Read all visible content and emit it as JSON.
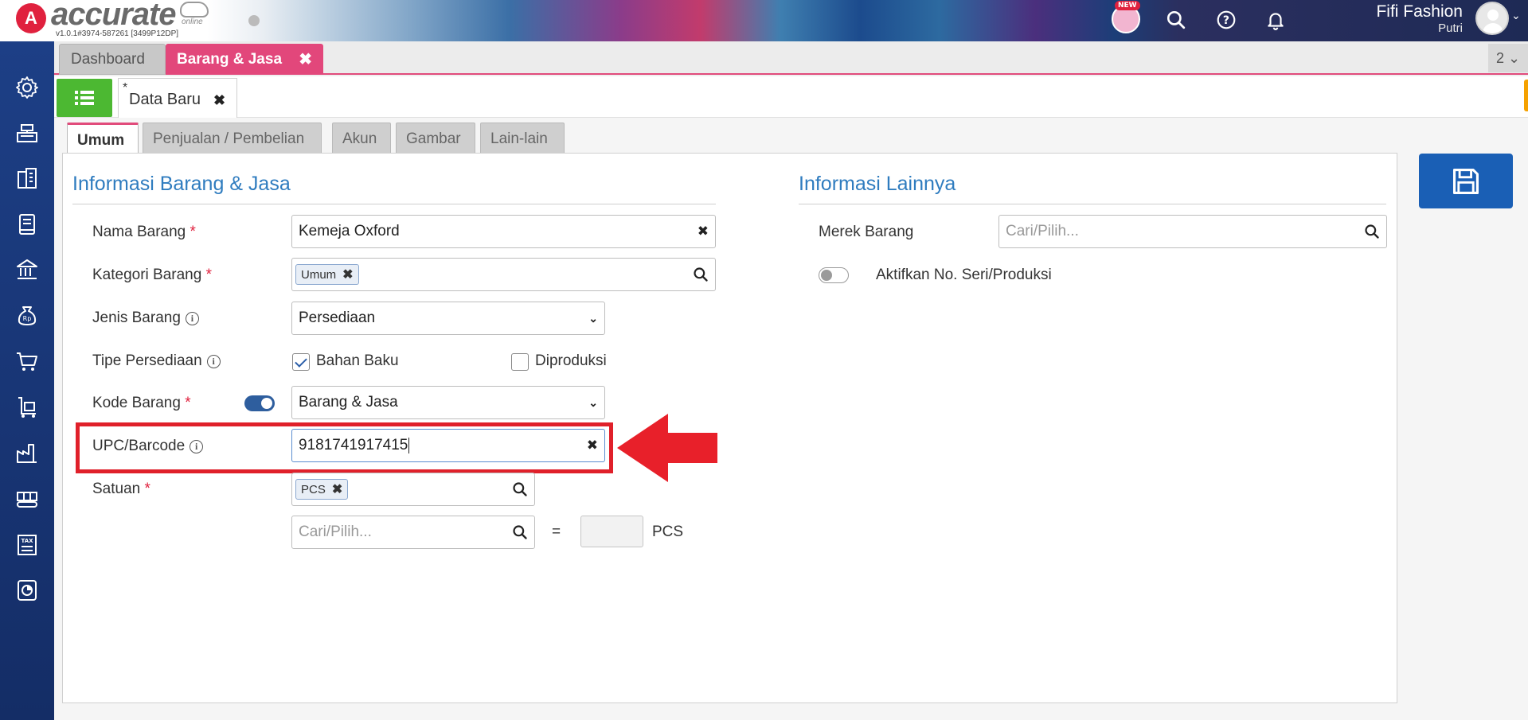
{
  "app": {
    "brand": "accurate",
    "brand_sub": "online",
    "version": "v1.0.1#3974-587261 [3499P12DP]",
    "logo_letter": "A",
    "new_badge": "NEW",
    "user_name": "Fifi Fashion",
    "user_sub": "Putri"
  },
  "tabs": {
    "dashboard": "Dashboard",
    "barang_jasa": "Barang & Jasa",
    "count": "2"
  },
  "subheader": {
    "star": "*",
    "tab_label": "Data Baru"
  },
  "form_tabs": [
    "Umum",
    "Penjualan / Pembelian",
    "Akun",
    "Gambar",
    "Lain-lain"
  ],
  "sections": {
    "left_title": "Informasi Barang & Jasa",
    "right_title": "Informasi Lainnya"
  },
  "fields": {
    "nama_label": "Nama Barang",
    "nama_value": "Kemeja Oxford",
    "kategori_label": "Kategori Barang",
    "kategori_chip": "Umum",
    "jenis_label": "Jenis Barang",
    "jenis_value": "Persediaan",
    "tipe_label": "Tipe Persediaan",
    "bahan_baku": "Bahan Baku",
    "diproduksi": "Diproduksi",
    "kode_label": "Kode Barang",
    "kode_value": "Barang & Jasa",
    "upc_label": "UPC/Barcode",
    "upc_value": "9181741917415",
    "satuan_label": "Satuan",
    "satuan_chip": "PCS",
    "satuan2_placeholder": "Cari/Pilih...",
    "equals": "=",
    "satuan_unit": "PCS",
    "merek_label": "Merek Barang",
    "merek_placeholder": "Cari/Pilih...",
    "seri_label": "Aktifkan No. Seri/Produksi",
    "required_mark": "*",
    "info_mark": "i",
    "clear_mark": "✖"
  },
  "states": {
    "bahan_baku_checked": true,
    "diproduksi_checked": false,
    "kode_toggle_on": true,
    "seri_toggle_on": false
  },
  "colors": {
    "accent_pink": "#e2477b",
    "primary_blue": "#1a5fb5",
    "title_blue": "#2f7cbf",
    "green": "#4cb832",
    "orange": "#f5a100",
    "highlight_red": "#e0202a"
  },
  "icons": {
    "sidebar": [
      "gear-icon",
      "cash-register-icon",
      "building-icon",
      "book-icon",
      "bank-icon",
      "money-bag-icon",
      "cart-icon",
      "trolley-icon",
      "factory-icon",
      "conveyor-icon",
      "tax-icon",
      "report-chart-icon"
    ]
  }
}
